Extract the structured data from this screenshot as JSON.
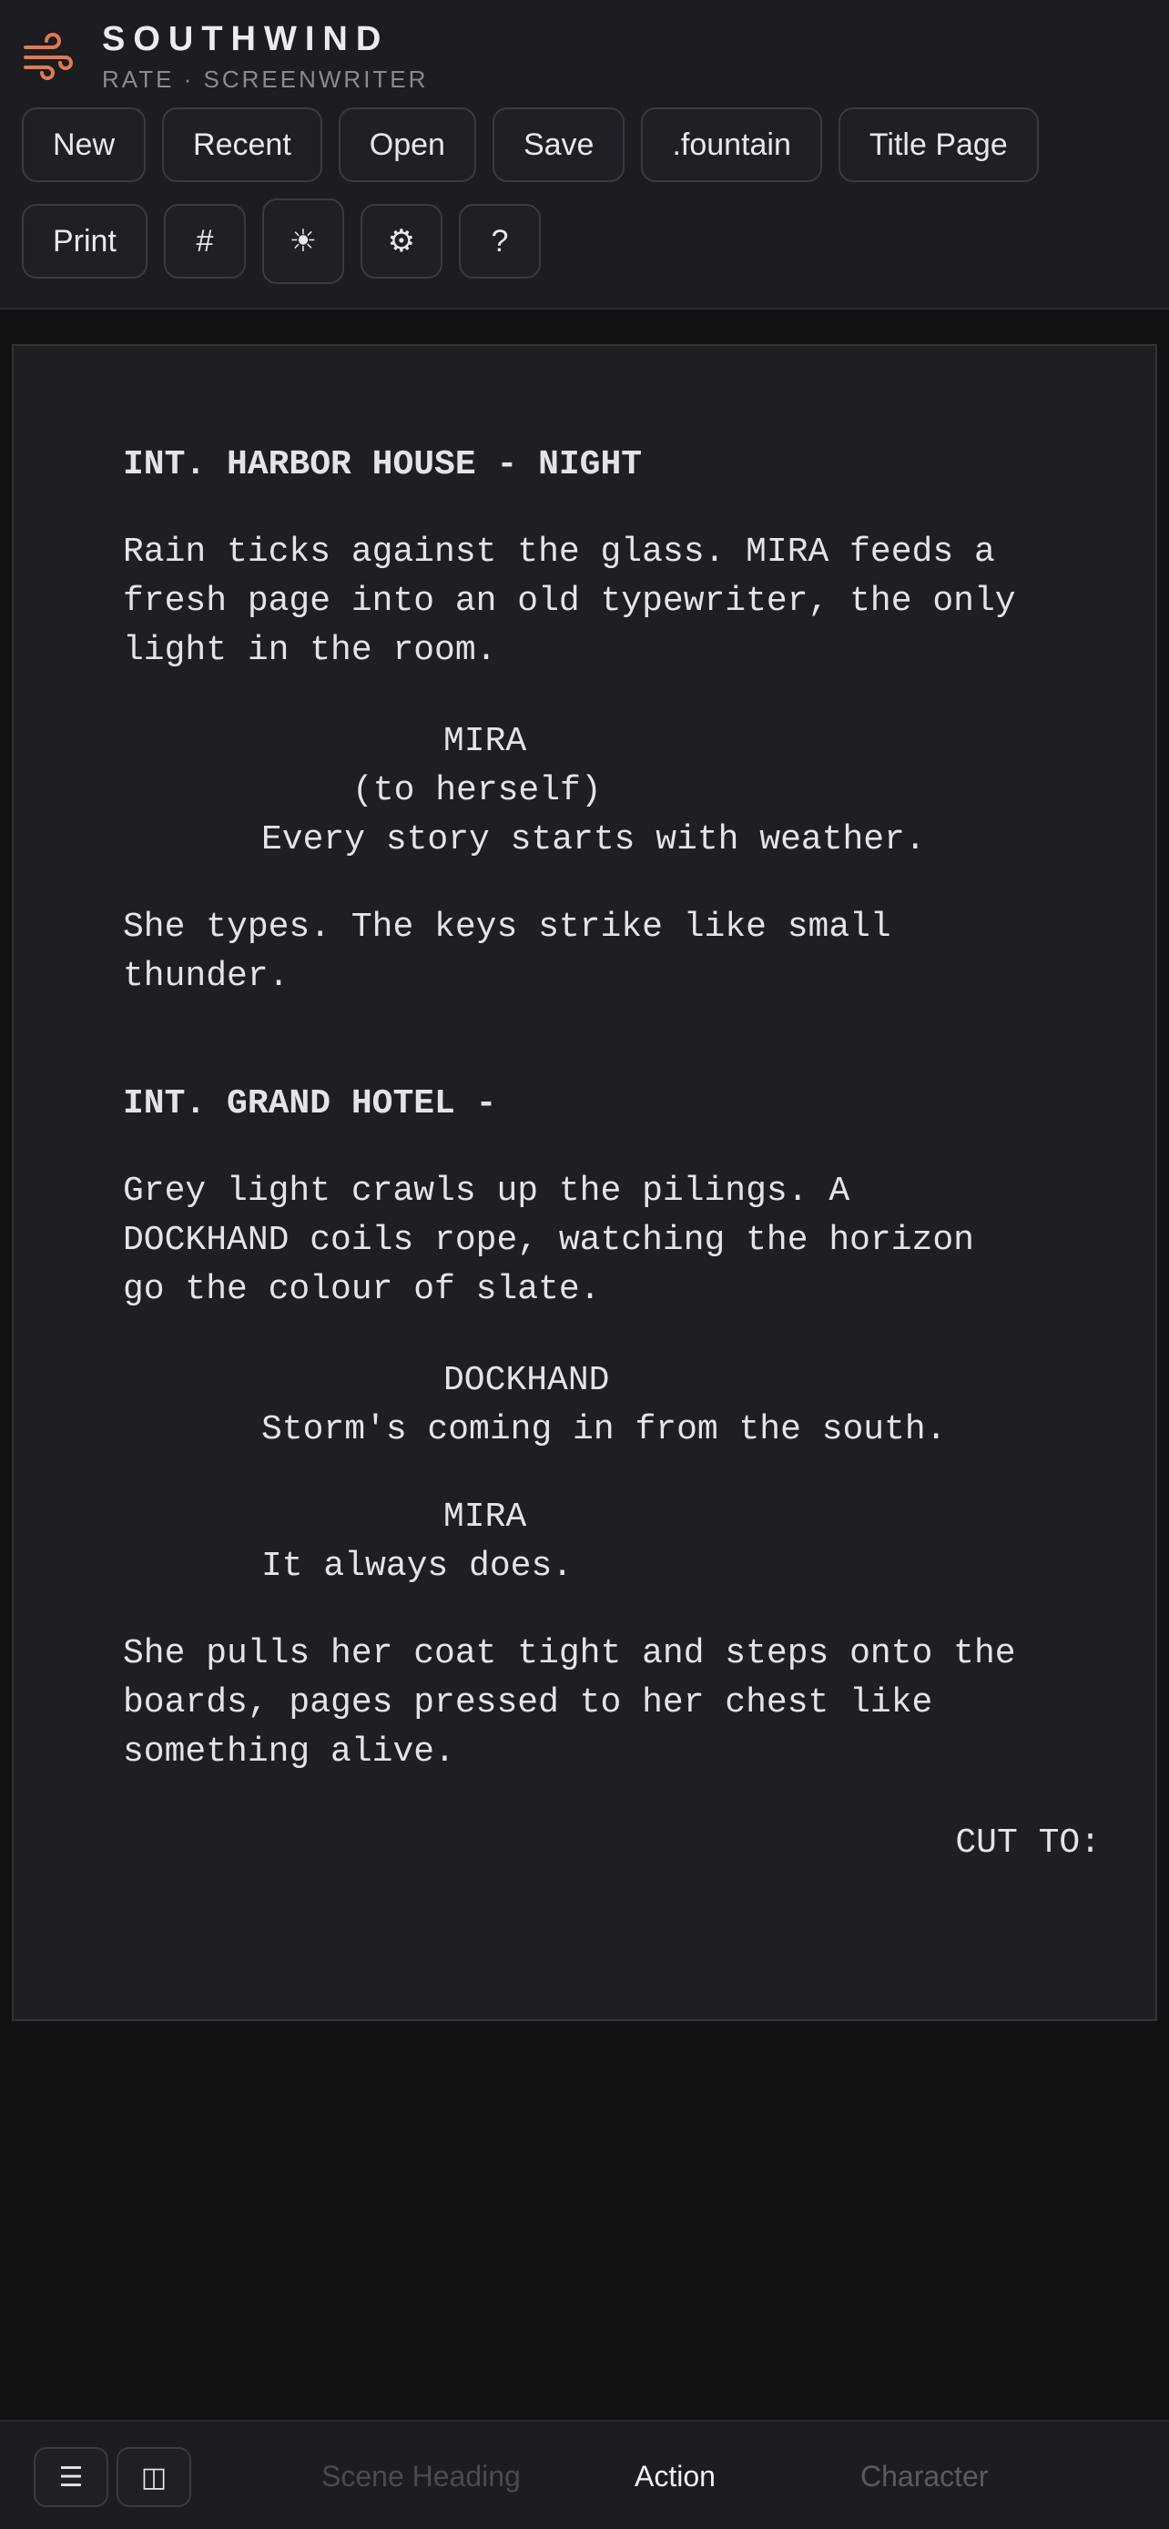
{
  "brand": {
    "name": "SOUTHWIND",
    "subtitle": "RATE · SCREENWRITER",
    "logo_icon": "wind-icon",
    "accent": "#e07a4f"
  },
  "toolbar": {
    "new": "New",
    "recent": "Recent",
    "open": "Open",
    "save": "Save",
    "fountain": ".fountain",
    "title_page": "Title Page",
    "print": "Print",
    "hash": "#",
    "theme_icon": "☀",
    "settings_icon": "⚙",
    "help": "?"
  },
  "script": {
    "scene1": "INT. HARBOR HOUSE - NIGHT",
    "action1": "Rain ticks against the glass. MIRA feeds a\nfresh page into an old typewriter, the only\nlight in the room.",
    "char1": "MIRA",
    "paren1": "(to herself)",
    "dialogue1": "Every story starts with weather.",
    "action2": "She types. The keys strike like small\nthunder.",
    "scene2": "INT. GRAND HOTEL -",
    "action3": "Grey light crawls up the pilings. A\nDOCKHAND coils rope, watching the horizon\ngo the colour of slate.",
    "char2": "DOCKHAND",
    "dialogue2": "Storm's coming in from the south.",
    "char3": "MIRA",
    "dialogue3": "It always does.",
    "action4": "She pulls her coat tight and steps onto the\nboards, pages pressed to her chest like\nsomething alive.",
    "transition": "CUT TO:"
  },
  "bottom_bar": {
    "menu_icon": "☰",
    "split_icon": "◫",
    "element_prev": "Scene Heading",
    "element_current": "Action",
    "element_next": "Character"
  }
}
